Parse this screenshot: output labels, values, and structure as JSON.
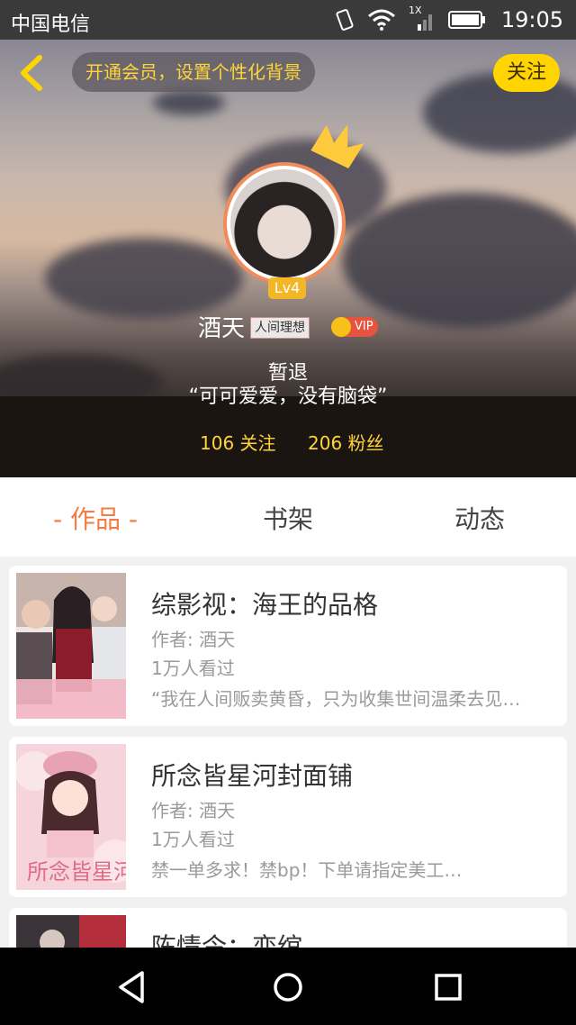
{
  "status_bar": {
    "carrier": "中国电信",
    "time": "19:05",
    "signal_label": "1X"
  },
  "header": {
    "vip_banner": "开通会员，设置个性化背景",
    "follow_label": "关注",
    "level": "Lv4",
    "user_name": "酒天",
    "title_tag": "人间理想",
    "vip_label": "VIP",
    "status": "暂退",
    "quote": "“可可爱爱，没有脑袋”",
    "following": "106 关注",
    "fans": "206 粉丝"
  },
  "tabs": [
    {
      "label": "- 作品 -",
      "active": true
    },
    {
      "label": "书架",
      "active": false
    },
    {
      "label": "动态",
      "active": false
    }
  ],
  "works": [
    {
      "title": "综影视：海王的品格",
      "author": "作者: 酒天",
      "views": "1万人看过",
      "desc": "“我在人间贩卖黄昏，只为收集世间温柔去见…"
    },
    {
      "title": "所念皆星河封面铺",
      "author": "作者: 酒天",
      "views": "1万人看过",
      "desc": "禁一单多求！禁bp！下单请指定美工…",
      "cover_text": "所念皆星河"
    },
    {
      "title": "陈情令：恋绾",
      "author": "",
      "views": "",
      "desc": ""
    }
  ],
  "colors": {
    "accent": "#f47b44",
    "yellow": "#ffd400",
    "vip_red": "#e6533e"
  }
}
